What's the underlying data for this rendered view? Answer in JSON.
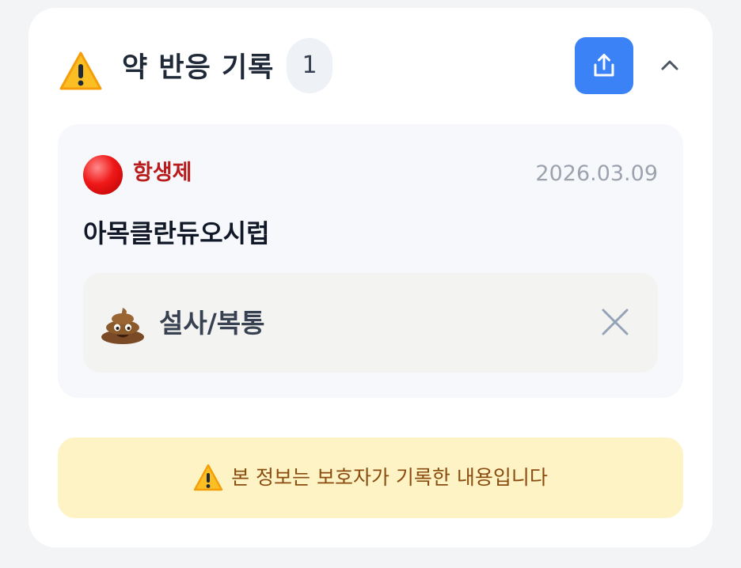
{
  "section": {
    "title": "약 반응 기록",
    "count": "1",
    "icons": {
      "warning": "warning-icon",
      "share": "share-icon",
      "collapse": "chevron-up-icon"
    }
  },
  "entries": [
    {
      "drug_class": "항생제",
      "drug_class_color": "#b91c1c",
      "indicator_color": "#ef1b1b",
      "date": "2026.03.09",
      "drug_name": "아목클란듀오시럽",
      "symptom": {
        "icon": "poop-icon",
        "label": "설사/복통",
        "remove_icon": "close-icon"
      }
    }
  ],
  "notice": {
    "icon": "warning-icon",
    "text": "본 정보는 보호자가 기록한 내용입니다"
  },
  "colors": {
    "accent": "#3b82f6",
    "notice_bg": "#fdf3c4",
    "notice_text": "#8a4b0f"
  }
}
